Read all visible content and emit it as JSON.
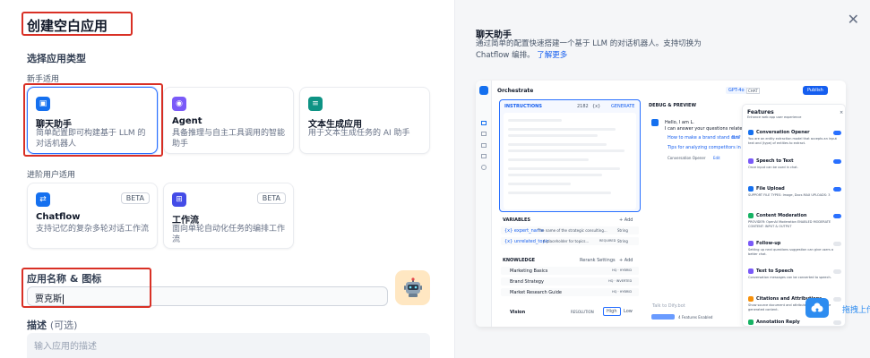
{
  "dialog": {
    "title": "创建空白应用",
    "section_type": "选择应用类型",
    "beginner_label": "新手适用",
    "advanced_label": "进阶用户适用",
    "name_label": "应用名称 & 图标",
    "name_value": "贾克斯",
    "desc_label": "描述",
    "desc_optional": "(可选)",
    "desc_placeholder": "输入应用的描述",
    "close_icon": "close-icon"
  },
  "app_types": [
    {
      "name": "聊天助手",
      "desc": "简单配置即可构建基于 LLM 的对话机器人",
      "color": "#1570ef",
      "icon": "chat-icon"
    },
    {
      "name": "Agent",
      "desc": "具备推理与自主工具调用的智能助手",
      "color": "#7a5af8",
      "icon": "agent-icon"
    },
    {
      "name": "文本生成应用",
      "desc": "用于文本生成任务的 AI 助手",
      "color": "#0e9384",
      "icon": "text-generator-icon"
    },
    {
      "name": "Chatflow",
      "desc": "支持记忆的复杂多轮对话工作流",
      "color": "#1570ef",
      "icon": "chatflow-icon",
      "badge": "BETA"
    },
    {
      "name": "工作流",
      "desc": "面向单轮自动化任务的编排工作流",
      "color": "#444ce7",
      "icon": "workflow-icon",
      "badge": "BETA"
    }
  ],
  "preview_panel": {
    "title": "聊天助手",
    "desc": "通过简单的配置快速搭建一个基于 LLM 的对话机器人。支持切换为 Chatflow 编排。",
    "link": "了解更多",
    "orchestrate": "Orchestrate",
    "model": "GPT-4o",
    "model_tag": "CHAT",
    "publish": "Publish",
    "instructions": "INSTRUCTIONS",
    "instr_count": "2182",
    "instr_var": "{x}",
    "generate": "GENERATE",
    "variables": "VARIABLES",
    "add": "+ Add",
    "vars": [
      {
        "key": "{x} expert_name",
        "desc": "The name of the strategic consulting...",
        "type": "String"
      },
      {
        "key": "{x} unrelated_topic",
        "desc": "A placeholder for topics...",
        "req": "REQUIRED",
        "type": "String"
      }
    ],
    "knowledge": "KNOWLEDGE",
    "rerank": "Rerank Settings",
    "kb": [
      {
        "name": "Marketing Basics",
        "tag": "HQ · HYBRID"
      },
      {
        "name": "Brand Strategy",
        "tag": "HQ · INVERTED"
      },
      {
        "name": "Market Research Guide",
        "tag": "HQ · HYBRID"
      }
    ],
    "vision": "Vision",
    "resolution": "RESOLUTION",
    "res_high": "High",
    "res_low": "Low",
    "debug": "DEBUG & PREVIEW",
    "hello": "Hello, I am L.",
    "hello2": "I can answer your questions related",
    "sugg1": "How to make a brand stand out?",
    "sugg1b": "Bra",
    "sugg2": "Tips for analyzing competitors in marke",
    "opener": "Conversation Opener",
    "edit": "Edit",
    "talk": "Talk to Dify.bot",
    "features_enabled": "4 Features Enabled",
    "features_title": "Features",
    "features_sub": "Enhance web app user experience",
    "features": [
      {
        "name": "Conversation Opener",
        "desc": "You are an entity extraction model that accepts an input text and (type) of entities to extract.",
        "on": true,
        "color": "#1570ef"
      },
      {
        "name": "Speech to Text",
        "desc": "Once input can be used in chat.",
        "on": true,
        "color": "#7a5af8"
      },
      {
        "name": "File Upload",
        "desc": "SUPPORT FILE TYPES: Image, Docs   MAX UPLOADS: 3",
        "on": true,
        "color": "#1570ef"
      },
      {
        "name": "Content Moderation",
        "desc": "PROVIDER: OpenAI Moderation   ENABLED MODERATE CONTENT: INPUT & OUTPUT",
        "on": true,
        "color": "#16b364"
      },
      {
        "name": "Follow-up",
        "desc": "Setting up next questions suggestion can give users a better chat.",
        "on": false,
        "color": "#7a5af8"
      },
      {
        "name": "Text to Speech",
        "desc": "Conversation messages can be converted to speech.",
        "on": false,
        "color": "#7a5af8"
      },
      {
        "name": "Citations and Attributions",
        "desc": "Show source document and attributed section of the generated content.",
        "on": false,
        "color": "#f79009"
      },
      {
        "name": "Annotation Reply",
        "desc": "",
        "on": false,
        "color": "#16b364"
      }
    ]
  },
  "upload_widget": {
    "label": "拖拽上传",
    "icon": "cloud-upload-icon"
  }
}
